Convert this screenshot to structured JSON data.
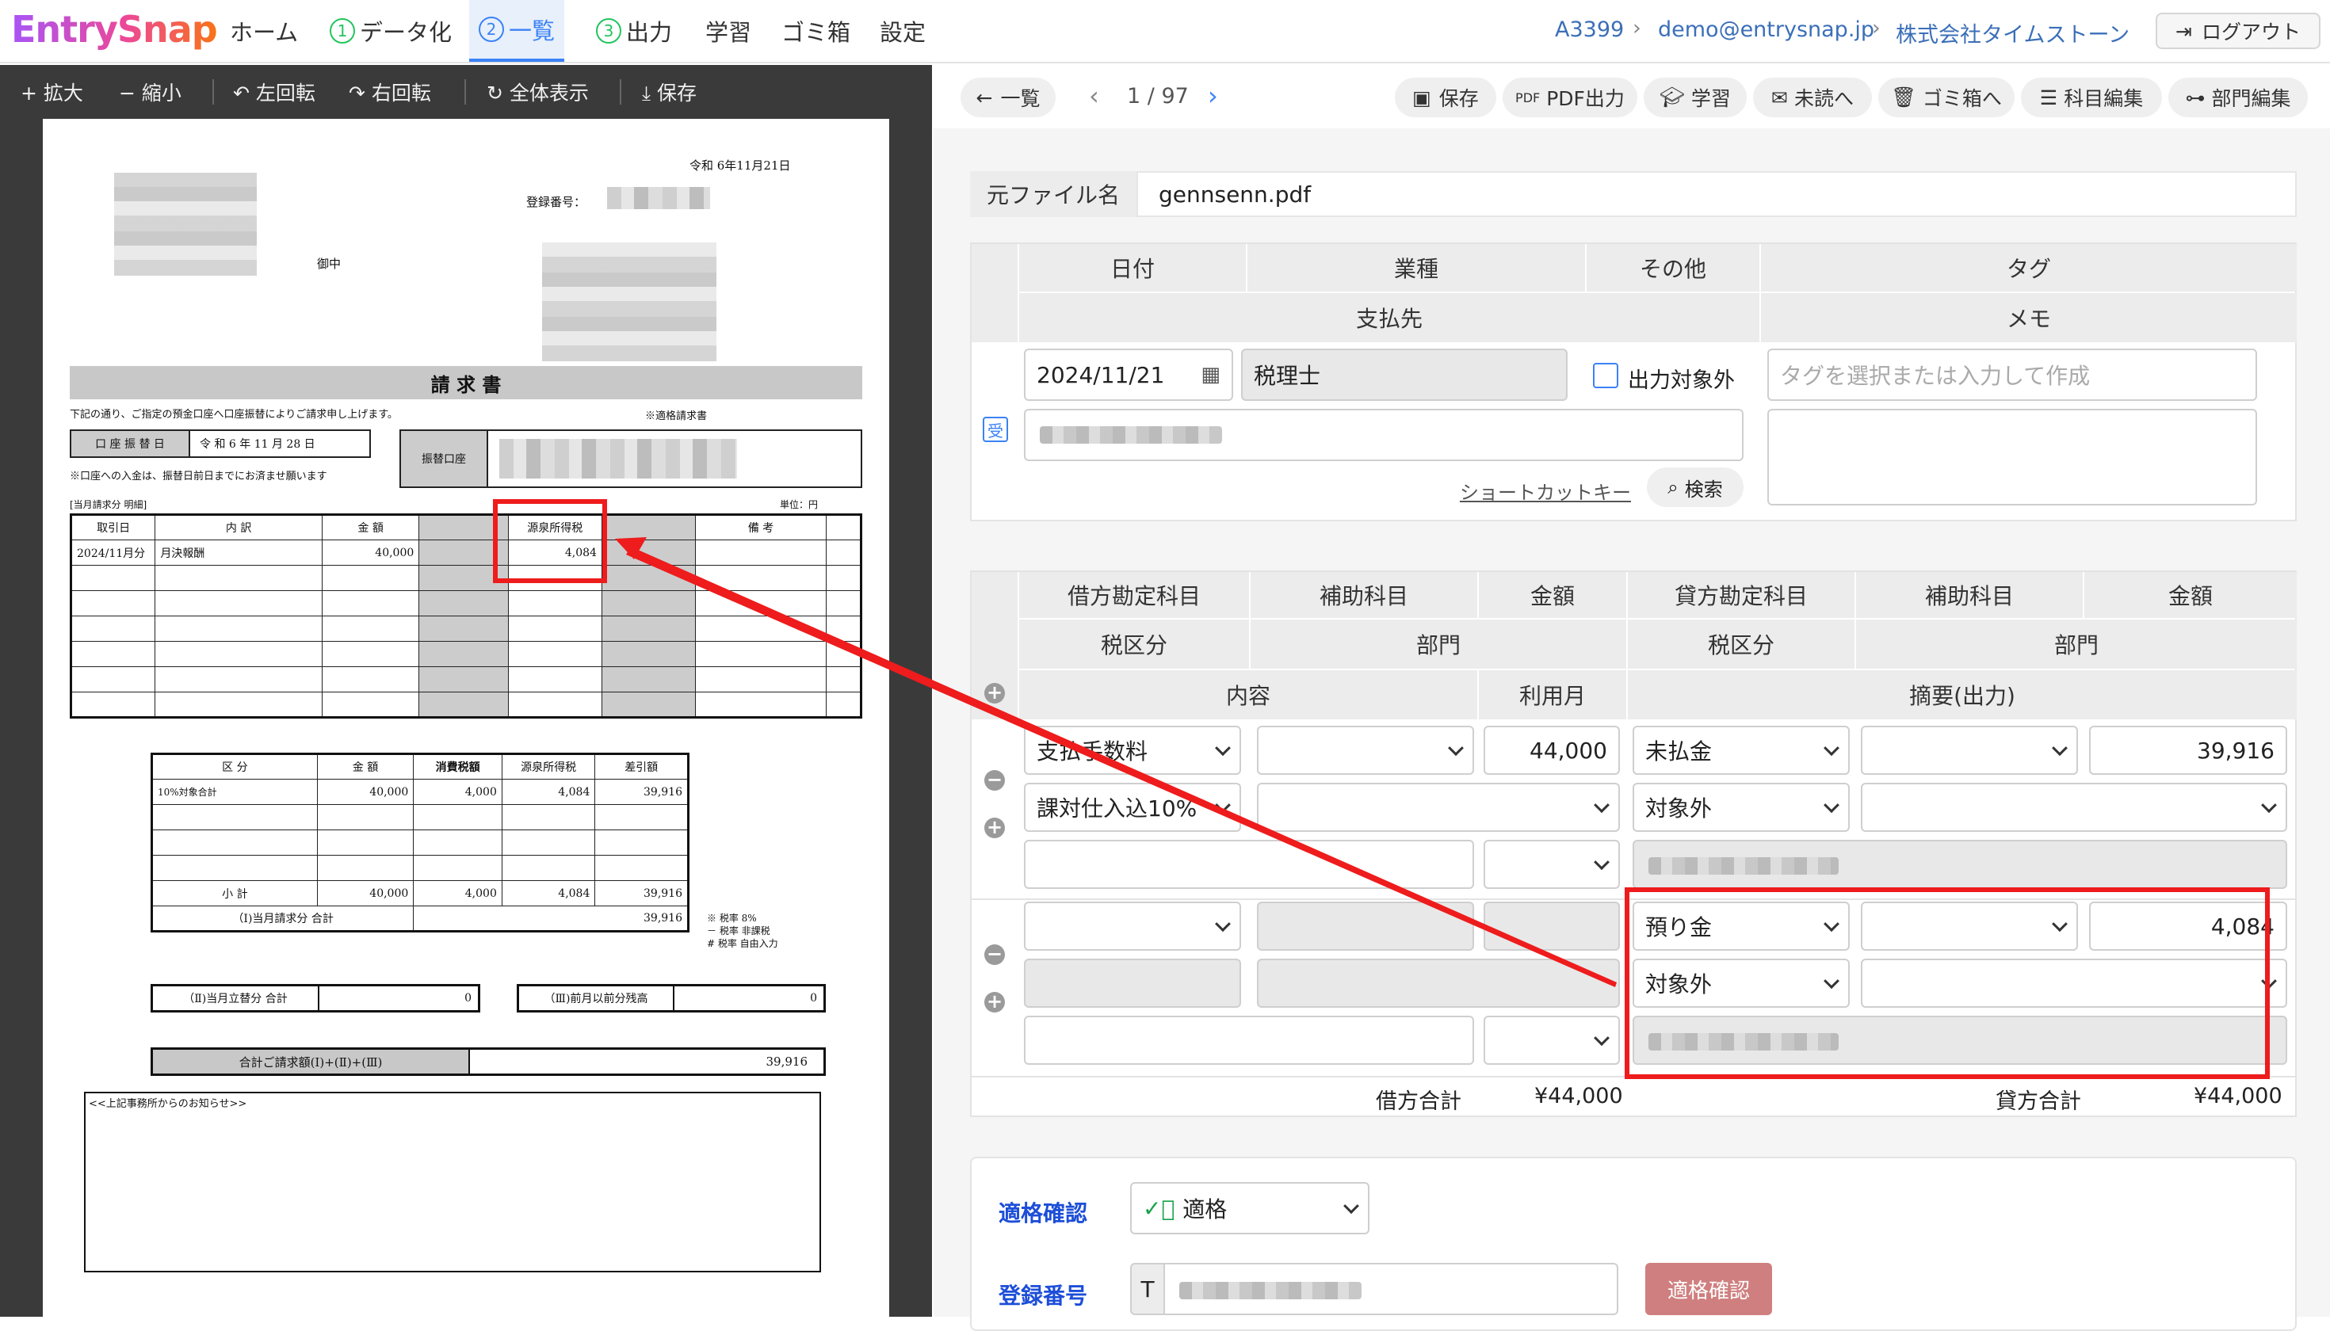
{
  "nav": {
    "logo": "EntrySnap",
    "home": "ホーム",
    "step1_num": "1",
    "step1": "データ化",
    "step2_num": "2",
    "step2": "一覧",
    "step3_num": "3",
    "step3": "出力",
    "learn": "学習",
    "trash": "ゴミ箱",
    "settings": "設定",
    "breadcrumb": [
      "A3399",
      "demo@entrysnap.jp",
      "株式会社タイムストーン"
    ],
    "logout": "ログアウト"
  },
  "viewer_toolbar": {
    "zoom_in": "+ 拡大",
    "zoom_out": "− 縮小",
    "rotate_left": "左回転",
    "rotate_right": "右回転",
    "fit": "全体表示",
    "save": "保存"
  },
  "invoice": {
    "date": "令和 6年11月21日",
    "reg_label": "登録番号：",
    "onchu": "御中",
    "title": "請 求 書",
    "intro": "下記の通り、ご指定の預金口座へ口座振替によりご請求申し上げます。",
    "tekikaku": "※適格請求書",
    "transfer_label": "口 座 振 替 日",
    "transfer_date": "令 和  6 年 11 月 28 日",
    "account_label": "振替口座",
    "note": "※口座への入金は、振替日前日までにお済ませ願います",
    "detail_label": "[当月請求分 明細]",
    "unit": "単位：円",
    "cols": [
      "取引日",
      "内 訳",
      "金 額",
      "",
      "源泉所得税",
      "",
      "備 考"
    ],
    "row1": [
      "2024/11月分",
      "月決報酬",
      "40,000",
      "",
      "4,084",
      "",
      ""
    ],
    "sum_cols": [
      "区 分",
      "金 額",
      "消費税額",
      "源泉所得税",
      "差引額"
    ],
    "sum_row1": [
      "10%対象合計",
      "40,000",
      "4,000",
      "4,084",
      "39,916"
    ],
    "subtotal": [
      "小 計",
      "40,000",
      "4,000",
      "4,084",
      "39,916"
    ],
    "total1_label": "（Ⅰ)当月請求分 合計",
    "total1": "39,916",
    "legend": [
      "※ 税率 8%",
      "－ 税率 非課税",
      "# 税率 自由入力"
    ],
    "total2_label": "（Ⅱ)当月立替分 合計",
    "total2": "0",
    "total3_label": "（Ⅲ)前月以前分残高",
    "total3": "0",
    "grand_label": "合計ご請求額(Ⅰ)+(Ⅱ)+(Ⅲ)",
    "grand": "39,916",
    "notice": "<<上記事務所からのお知らせ>>"
  },
  "rp_toolbar": {
    "back": "一覧",
    "pager": "1 / 97",
    "save": "保存",
    "pdf": "PDF出力",
    "learn": "学習",
    "unread": "未読へ",
    "trash": "ゴミ箱へ",
    "accounts": "科目編集",
    "depts": "部門編集"
  },
  "file": {
    "label": "元ファイル名",
    "value": "gennsenn.pdf"
  },
  "header_fields": {
    "date_h": "日付",
    "industry_h": "業種",
    "other_h": "その他",
    "tag_h": "タグ",
    "payee_h": "支払先",
    "memo_h": "メモ",
    "date": "2024/11/21",
    "industry": "税理士",
    "exclude": "出力対象外",
    "tag_placeholder": "タグを選択または入力して作成",
    "recv_badge": "受",
    "shortcut": "ショートカットキー",
    "search": "検索"
  },
  "journal": {
    "h_debit": "借方勘定科目",
    "h_sub1": "補助科目",
    "h_amt1": "金額",
    "h_credit": "貸方勘定科目",
    "h_sub2": "補助科目",
    "h_amt2": "金額",
    "h_tax1": "税区分",
    "h_dept1": "部門",
    "h_tax2": "税区分",
    "h_dept2": "部門",
    "h_content": "内容",
    "h_month": "利用月",
    "h_summary": "摘要(出力)",
    "r1_debit": "支払手数料",
    "r1_amt": "44,000",
    "r1_credit": "未払金",
    "r1_camt": "39,916",
    "r1_dtax": "課対仕入込10%",
    "r1_ctax": "対象外",
    "r2_credit": "預り金",
    "r2_camt": "4,084",
    "r2_ctax": "対象外",
    "debit_total_label": "借方合計",
    "debit_total": "¥44,000",
    "credit_total_label": "貸方合計",
    "credit_total": "¥44,000"
  },
  "qualify": {
    "label": "適格確認",
    "value": "適格",
    "reg_label": "登録番号",
    "reg_prefix": "T",
    "check_btn": "適格確認"
  },
  "colors": {
    "accent": "#3b82f6",
    "annotation": "#ee1c1c",
    "step": "#22c55e"
  }
}
